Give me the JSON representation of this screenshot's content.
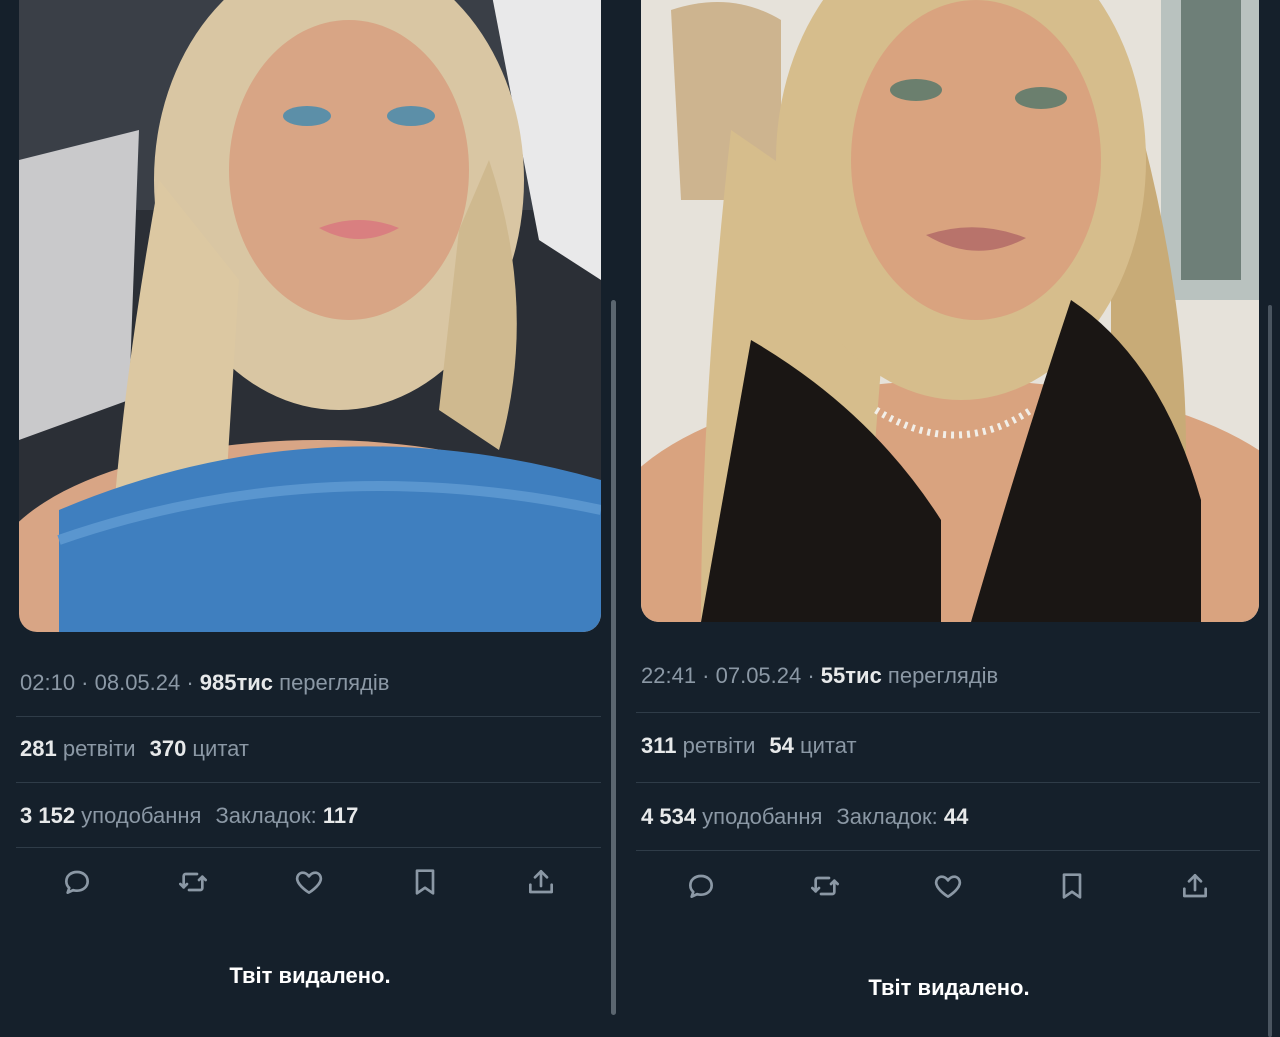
{
  "tweets": [
    {
      "timestamp": "02:10 · 08.05.24 · ",
      "views_count": "985тис",
      "views_label": " переглядів",
      "retweets_count": "281",
      "retweets_label": " ретвіти",
      "quotes_count": "370",
      "quotes_label": " цитат",
      "likes_count": "3 152",
      "likes_label": " уподобання",
      "bookmarks_label": "Закладок: ",
      "bookmarks_count": "117",
      "deleted_notice": "Твіт видалено.",
      "photo": {
        "top_color": "#2b2f36",
        "clothing_color": "#3f7fbf",
        "hair_color": "#d9c6a3",
        "skin_color": "#d8a585"
      }
    },
    {
      "timestamp": "22:41 · 07.05.24 · ",
      "views_count": "55тис",
      "views_label": " переглядів",
      "retweets_count": "311",
      "retweets_label": " ретвіти",
      "quotes_count": "54",
      "quotes_label": " цитат",
      "likes_count": "4 534",
      "likes_label": " уподобання",
      "bookmarks_label": "Закладок: ",
      "bookmarks_count": "44",
      "deleted_notice": "Твіт видалено.",
      "photo": {
        "top_color": "#d9d4cc",
        "clothing_color": "#1a1614",
        "hair_color": "#d6bd8c",
        "skin_color": "#d9a37f"
      }
    }
  ],
  "actions": [
    "reply-icon",
    "retweet-icon",
    "like-icon",
    "bookmark-icon",
    "share-icon"
  ],
  "colors": {
    "background": "#15202b",
    "muted_text": "#8b98a5",
    "primary_text": "#e7e9ea",
    "divider": "#2f3c48"
  }
}
